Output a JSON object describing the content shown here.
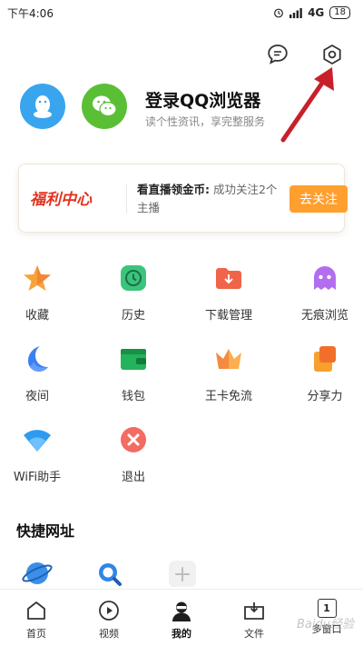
{
  "status_bar": {
    "time": "下午4:06",
    "network": "4G",
    "battery": "18"
  },
  "header": {
    "icons": [
      "message-icon",
      "settings-icon"
    ]
  },
  "login": {
    "title": "登录QQ浏览器",
    "subtitle": "读个性资讯，享完整服务"
  },
  "welfare": {
    "logo": "福利中心",
    "text_bold": "看直播领金币:",
    "text_rest": " 成功关注2个主播",
    "button": "去关注"
  },
  "grid": [
    {
      "label": "收藏",
      "icon": "star-icon"
    },
    {
      "label": "历史",
      "icon": "clock-icon"
    },
    {
      "label": "下载管理",
      "icon": "download-icon"
    },
    {
      "label": "无痕浏览",
      "icon": "ghost-icon"
    },
    {
      "label": "夜间",
      "icon": "moon-icon"
    },
    {
      "label": "钱包",
      "icon": "wallet-icon"
    },
    {
      "label": "王卡免流",
      "icon": "crown-icon"
    },
    {
      "label": "分享力",
      "icon": "share-icon"
    },
    {
      "label": "WiFi助手",
      "icon": "wifi-icon"
    },
    {
      "label": "退出",
      "icon": "exit-icon"
    }
  ],
  "shortcuts": {
    "title": "快捷网址"
  },
  "nav": [
    {
      "label": "首页",
      "icon": "home-icon"
    },
    {
      "label": "视频",
      "icon": "video-icon"
    },
    {
      "label": "我的",
      "icon": "profile-icon",
      "active": true
    },
    {
      "label": "文件",
      "icon": "file-icon"
    },
    {
      "label": "多窗口",
      "icon": "window-icon",
      "count": "1"
    }
  ],
  "watermark": "Baidu经验",
  "colors": {
    "accent": "#ff9f2e",
    "qq": "#3aa5ef",
    "wechat": "#5bbf35",
    "arrow": "#c8202a"
  }
}
